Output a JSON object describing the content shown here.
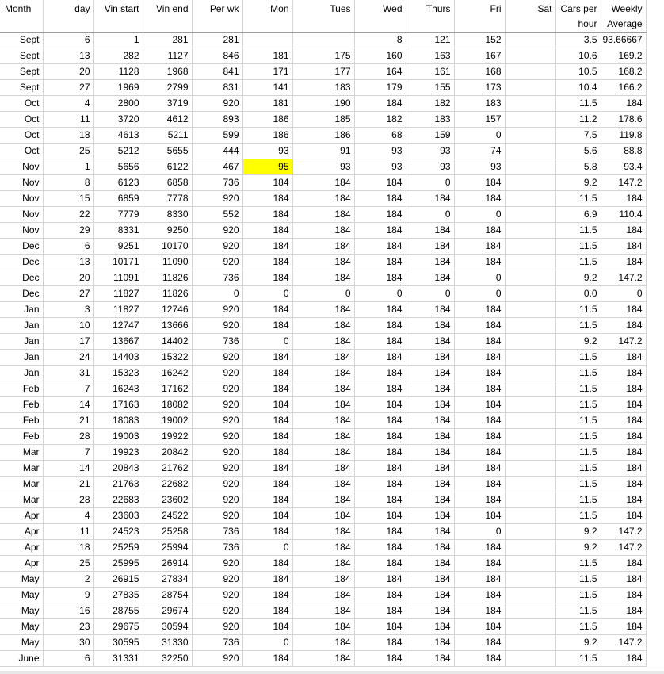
{
  "headers": [
    "Month",
    "day",
    "Vin start",
    "Vin end",
    "Per wk",
    "Mon",
    "Tues",
    "Wed",
    "Thurs",
    "Fri",
    "Sat",
    "Cars per hour",
    "Weekly Average"
  ],
  "rows": [
    [
      "Sept",
      "6",
      "1",
      "281",
      "281",
      "",
      "",
      "8",
      "121",
      "152",
      "",
      "3.5",
      "93.66667"
    ],
    [
      "Sept",
      "13",
      "282",
      "1127",
      "846",
      "181",
      "175",
      "160",
      "163",
      "167",
      "",
      "10.6",
      "169.2"
    ],
    [
      "Sept",
      "20",
      "1128",
      "1968",
      "841",
      "171",
      "177",
      "164",
      "161",
      "168",
      "",
      "10.5",
      "168.2"
    ],
    [
      "Sept",
      "27",
      "1969",
      "2799",
      "831",
      "141",
      "183",
      "179",
      "155",
      "173",
      "",
      "10.4",
      "166.2"
    ],
    [
      "Oct",
      "4",
      "2800",
      "3719",
      "920",
      "181",
      "190",
      "184",
      "182",
      "183",
      "",
      "11.5",
      "184"
    ],
    [
      "Oct",
      "11",
      "3720",
      "4612",
      "893",
      "186",
      "185",
      "182",
      "183",
      "157",
      "",
      "11.2",
      "178.6"
    ],
    [
      "Oct",
      "18",
      "4613",
      "5211",
      "599",
      "186",
      "186",
      "68",
      "159",
      "0",
      "",
      "7.5",
      "119.8"
    ],
    [
      "Oct",
      "25",
      "5212",
      "5655",
      "444",
      "93",
      "91",
      "93",
      "93",
      "74",
      "",
      "5.6",
      "88.8"
    ],
    [
      "Nov",
      "1",
      "5656",
      "6122",
      "467",
      "95",
      "93",
      "93",
      "93",
      "93",
      "",
      "5.8",
      "93.4"
    ],
    [
      "Nov",
      "8",
      "6123",
      "6858",
      "736",
      "184",
      "184",
      "184",
      "0",
      "184",
      "",
      "9.2",
      "147.2"
    ],
    [
      "Nov",
      "15",
      "6859",
      "7778",
      "920",
      "184",
      "184",
      "184",
      "184",
      "184",
      "",
      "11.5",
      "184"
    ],
    [
      "Nov",
      "22",
      "7779",
      "8330",
      "552",
      "184",
      "184",
      "184",
      "0",
      "0",
      "",
      "6.9",
      "110.4"
    ],
    [
      "Nov",
      "29",
      "8331",
      "9250",
      "920",
      "184",
      "184",
      "184",
      "184",
      "184",
      "",
      "11.5",
      "184"
    ],
    [
      "Dec",
      "6",
      "9251",
      "10170",
      "920",
      "184",
      "184",
      "184",
      "184",
      "184",
      "",
      "11.5",
      "184"
    ],
    [
      "Dec",
      "13",
      "10171",
      "11090",
      "920",
      "184",
      "184",
      "184",
      "184",
      "184",
      "",
      "11.5",
      "184"
    ],
    [
      "Dec",
      "20",
      "11091",
      "11826",
      "736",
      "184",
      "184",
      "184",
      "184",
      "0",
      "",
      "9.2",
      "147.2"
    ],
    [
      "Dec",
      "27",
      "11827",
      "11826",
      "0",
      "0",
      "0",
      "0",
      "0",
      "0",
      "",
      "0.0",
      "0"
    ],
    [
      "Jan",
      "3",
      "11827",
      "12746",
      "920",
      "184",
      "184",
      "184",
      "184",
      "184",
      "",
      "11.5",
      "184"
    ],
    [
      "Jan",
      "10",
      "12747",
      "13666",
      "920",
      "184",
      "184",
      "184",
      "184",
      "184",
      "",
      "11.5",
      "184"
    ],
    [
      "Jan",
      "17",
      "13667",
      "14402",
      "736",
      "0",
      "184",
      "184",
      "184",
      "184",
      "",
      "9.2",
      "147.2"
    ],
    [
      "Jan",
      "24",
      "14403",
      "15322",
      "920",
      "184",
      "184",
      "184",
      "184",
      "184",
      "",
      "11.5",
      "184"
    ],
    [
      "Jan",
      "31",
      "15323",
      "16242",
      "920",
      "184",
      "184",
      "184",
      "184",
      "184",
      "",
      "11.5",
      "184"
    ],
    [
      "Feb",
      "7",
      "16243",
      "17162",
      "920",
      "184",
      "184",
      "184",
      "184",
      "184",
      "",
      "11.5",
      "184"
    ],
    [
      "Feb",
      "14",
      "17163",
      "18082",
      "920",
      "184",
      "184",
      "184",
      "184",
      "184",
      "",
      "11.5",
      "184"
    ],
    [
      "Feb",
      "21",
      "18083",
      "19002",
      "920",
      "184",
      "184",
      "184",
      "184",
      "184",
      "",
      "11.5",
      "184"
    ],
    [
      "Feb",
      "28",
      "19003",
      "19922",
      "920",
      "184",
      "184",
      "184",
      "184",
      "184",
      "",
      "11.5",
      "184"
    ],
    [
      "Mar",
      "7",
      "19923",
      "20842",
      "920",
      "184",
      "184",
      "184",
      "184",
      "184",
      "",
      "11.5",
      "184"
    ],
    [
      "Mar",
      "14",
      "20843",
      "21762",
      "920",
      "184",
      "184",
      "184",
      "184",
      "184",
      "",
      "11.5",
      "184"
    ],
    [
      "Mar",
      "21",
      "21763",
      "22682",
      "920",
      "184",
      "184",
      "184",
      "184",
      "184",
      "",
      "11.5",
      "184"
    ],
    [
      "Mar",
      "28",
      "22683",
      "23602",
      "920",
      "184",
      "184",
      "184",
      "184",
      "184",
      "",
      "11.5",
      "184"
    ],
    [
      "Apr",
      "4",
      "23603",
      "24522",
      "920",
      "184",
      "184",
      "184",
      "184",
      "184",
      "",
      "11.5",
      "184"
    ],
    [
      "Apr",
      "11",
      "24523",
      "25258",
      "736",
      "184",
      "184",
      "184",
      "184",
      "0",
      "",
      "9.2",
      "147.2"
    ],
    [
      "Apr",
      "18",
      "25259",
      "25994",
      "736",
      "0",
      "184",
      "184",
      "184",
      "184",
      "",
      "9.2",
      "147.2"
    ],
    [
      "Apr",
      "25",
      "25995",
      "26914",
      "920",
      "184",
      "184",
      "184",
      "184",
      "184",
      "",
      "11.5",
      "184"
    ],
    [
      "May",
      "2",
      "26915",
      "27834",
      "920",
      "184",
      "184",
      "184",
      "184",
      "184",
      "",
      "11.5",
      "184"
    ],
    [
      "May",
      "9",
      "27835",
      "28754",
      "920",
      "184",
      "184",
      "184",
      "184",
      "184",
      "",
      "11.5",
      "184"
    ],
    [
      "May",
      "16",
      "28755",
      "29674",
      "920",
      "184",
      "184",
      "184",
      "184",
      "184",
      "",
      "11.5",
      "184"
    ],
    [
      "May",
      "23",
      "29675",
      "30594",
      "920",
      "184",
      "184",
      "184",
      "184",
      "184",
      "",
      "11.5",
      "184"
    ],
    [
      "May",
      "30",
      "30595",
      "31330",
      "736",
      "0",
      "184",
      "184",
      "184",
      "184",
      "",
      "9.2",
      "147.2"
    ],
    [
      "June",
      "6",
      "31331",
      "32250",
      "920",
      "184",
      "184",
      "184",
      "184",
      "184",
      "",
      "11.5",
      "184"
    ]
  ],
  "highlight": {
    "row": 8,
    "col": 5,
    "color": "#ffff00"
  }
}
